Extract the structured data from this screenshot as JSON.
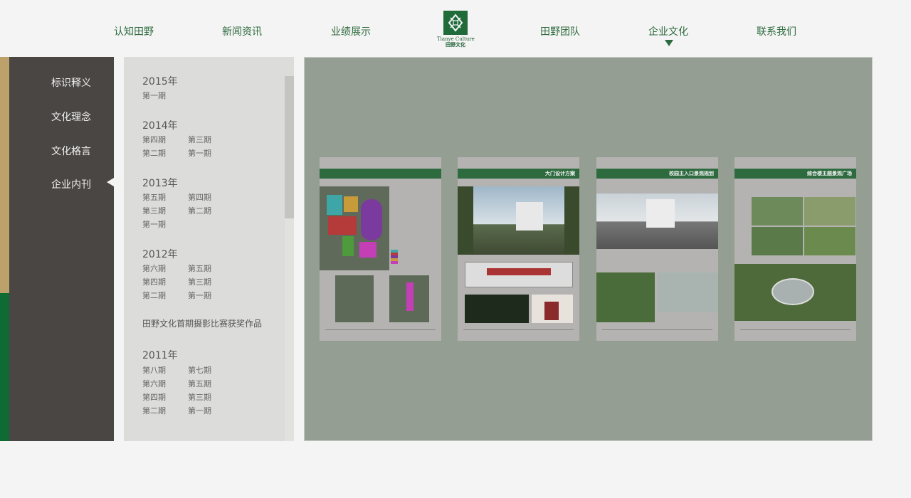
{
  "nav": {
    "items": [
      "认知田野",
      "新闻资讯",
      "业绩展示",
      "田野团队",
      "企业文化",
      "联系我们"
    ],
    "active": "企业文化"
  },
  "logo": {
    "en": "Tianye Culture",
    "cn": "田野文化"
  },
  "sidebar": {
    "items": [
      "标识释义",
      "文化理念",
      "文化格言",
      "企业内刊"
    ],
    "active": "企业内刊"
  },
  "issues": {
    "y2015": {
      "year": "2015年",
      "list": [
        "第一期"
      ]
    },
    "y2014": {
      "year": "2014年",
      "list": [
        "第四期",
        "第三期",
        "第二期",
        "第一期"
      ]
    },
    "y2013": {
      "year": "2013年",
      "list": [
        "第五期",
        "第四期",
        "第三期",
        "第二期",
        "第一期"
      ]
    },
    "y2012": {
      "year": "2012年",
      "list": [
        "第六期",
        "第五期",
        "第四期",
        "第三期",
        "第二期",
        "第一期"
      ]
    },
    "special": "田野文化首期摄影比赛获奖作品",
    "y2011": {
      "year": "2011年",
      "list": [
        "第八期",
        "第七期",
        "第六期",
        "第五期",
        "第四期",
        "第三期",
        "第二期",
        "第一期"
      ]
    }
  },
  "pages": {
    "p1": {
      "title": ""
    },
    "p2": {
      "title": "大门设计方案"
    },
    "p3": {
      "title": "校园主入口景观规划"
    },
    "p4": {
      "title": "综合楼主题景观广场"
    },
    "colors": {
      "brand_green": "#2d6b3f",
      "viewer_bg": "#959e93"
    }
  }
}
